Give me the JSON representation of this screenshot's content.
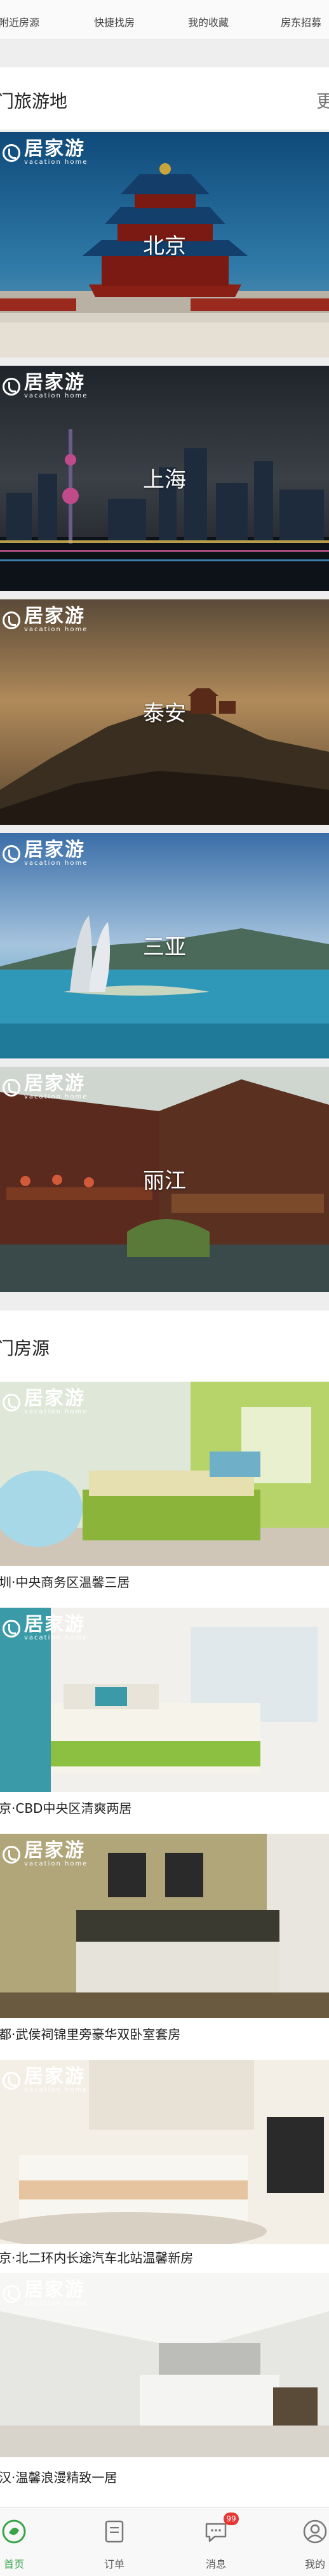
{
  "topnav": {
    "items": [
      "附近房源",
      "快捷找房",
      "我的收藏",
      "房东招募"
    ]
  },
  "hot_destinations": {
    "title": "门旅游地",
    "more": "更",
    "brand_cn": "居家游",
    "brand_en": "vacation home",
    "cities": [
      "北京",
      "上海",
      "泰安",
      "三亚",
      "丽江"
    ]
  },
  "hot_houses": {
    "title": "门房源",
    "listings": [
      "圳·中央商务区温馨三居",
      "京·CBD中央区清爽两居",
      "都·武侯祠锦里旁豪华双卧室套房",
      "京·北二环内长途汽车北站温馨新房",
      "汉·温馨浪漫精致一居"
    ]
  },
  "tabbar": {
    "tabs": [
      "首页",
      "订单",
      "消息",
      "我的"
    ],
    "message_badge": "99",
    "active_color": "#3aa34a"
  }
}
